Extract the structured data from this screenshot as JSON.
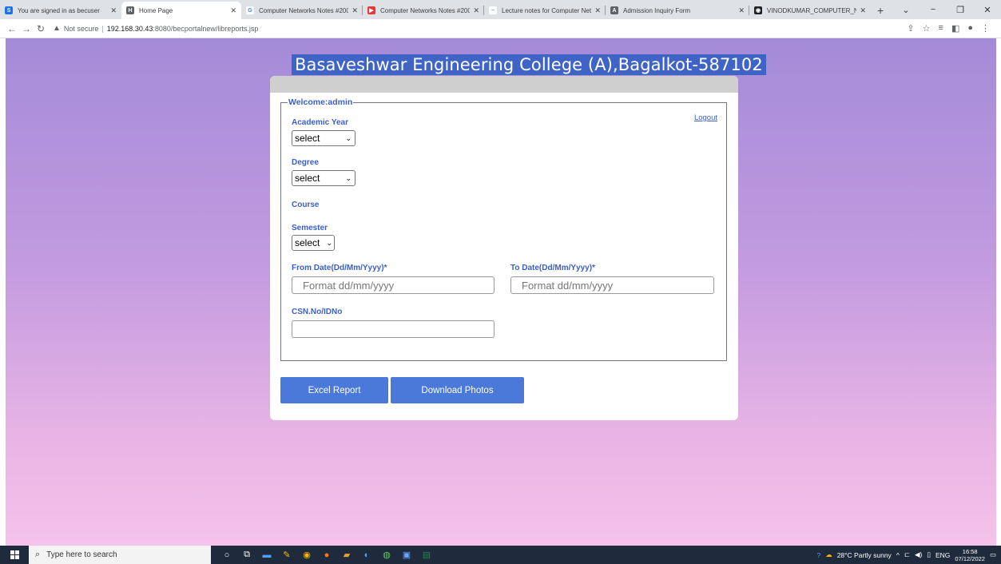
{
  "browser": {
    "tabs": [
      {
        "label": "You are signed in as becuser",
        "favicon": "S",
        "color": "#1a73e8"
      },
      {
        "label": "Home Page",
        "favicon": "H",
        "color": "#5f6368",
        "active": true
      },
      {
        "label": "Computer Networks Notes #200",
        "favicon": "G",
        "color": "#4285f4"
      },
      {
        "label": "Computer Networks Notes #200",
        "favicon": "Y",
        "color": "#e53935"
      },
      {
        "label": "Lecture notes for Computer Net",
        "favicon": "~",
        "color": "#4aa1e0"
      },
      {
        "label": "Admission Inquiry Form",
        "favicon": "A",
        "color": "#5f6368"
      },
      {
        "label": "VINODKUMAR_COMPUTER_NET",
        "favicon": "V",
        "color": "#202124"
      }
    ],
    "new_tab": "+",
    "window_controls": {
      "dropdown": "⌄",
      "minimize": "−",
      "restore": "❐",
      "close": "✕"
    },
    "address": {
      "security": "Not secure",
      "host": "192.168.30.43",
      "path": ":8080/becportalnew/libreports.jsp"
    }
  },
  "page": {
    "college_title": "Basaveshwar Engineering College (A),Bagalkot-587102",
    "welcome": "Welcome:admin",
    "logout": "Logout",
    "fields": {
      "academic_year": {
        "label": "Academic Year",
        "value": "select"
      },
      "degree": {
        "label": "Degree",
        "value": "select"
      },
      "course": {
        "label": "Course"
      },
      "semester": {
        "label": "Semester",
        "value": "select"
      },
      "from_date": {
        "label": "From Date(Dd/Mm/Yyyy)*",
        "placeholder": "Format dd/mm/yyyy"
      },
      "to_date": {
        "label": "To Date(Dd/Mm/Yyyy)*",
        "placeholder": "Format dd/mm/yyyy"
      },
      "csn": {
        "label": "CSN.No/IDNo",
        "value": ""
      }
    },
    "buttons": {
      "excel": "Excel Report",
      "photos": "Download Photos",
      "arrow": "-->"
    }
  },
  "taskbar": {
    "search_placeholder": "Type here to search",
    "weather": "28°C  Partly sunny",
    "language": "ENG",
    "time": "16:58",
    "date": "07/12/2022"
  },
  "colors": {
    "accent": "#3b5fc8",
    "button": "#4a79d9",
    "title_highlight": "#3f64c6"
  }
}
